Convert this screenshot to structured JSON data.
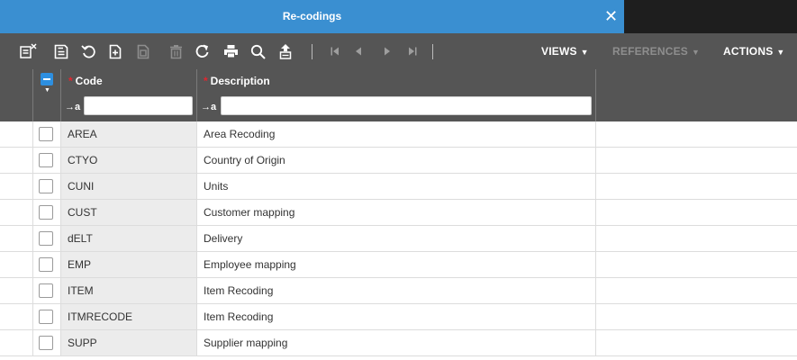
{
  "window": {
    "title": "Re-codings",
    "close_symbol": "✕"
  },
  "toolbar": {
    "icons": [
      "clear-selection-icon",
      "save-icon",
      "undo-icon",
      "new-record-icon",
      "copy-record-icon",
      "delete-icon",
      "refresh-icon",
      "print-icon",
      "search-icon",
      "export-icon",
      "first-record-icon",
      "previous-record-icon",
      "next-record-icon",
      "last-record-icon"
    ],
    "views_label": "VIEWS",
    "references_label": "REFERENCES",
    "actions_label": "ACTIONS",
    "caret": "▼"
  },
  "grid": {
    "columns": [
      {
        "label": "Code",
        "required_marker": "*",
        "filter_prefix": "→a",
        "filter_value": ""
      },
      {
        "label": "Description",
        "required_marker": "*",
        "filter_prefix": "→a",
        "filter_value": ""
      }
    ],
    "rows": [
      {
        "code": "AREA",
        "description": "Area Recoding"
      },
      {
        "code": "CTYO",
        "description": "Country of Origin"
      },
      {
        "code": "CUNI",
        "description": "Units"
      },
      {
        "code": "CUST",
        "description": "Customer mapping"
      },
      {
        "code": "dELT",
        "description": "Delivery"
      },
      {
        "code": "EMP",
        "description": "Employee mapping"
      },
      {
        "code": "ITEM",
        "description": "Item Recoding"
      },
      {
        "code": "ITMRECODE",
        "description": "Item Recoding"
      },
      {
        "code": "SUPP",
        "description": "Supplier mapping"
      }
    ]
  },
  "colors": {
    "title_bar": "#3a8fd1",
    "toolbar": "#555555",
    "required": "#e2262f",
    "checkbox_accent": "#2d8fe0"
  }
}
